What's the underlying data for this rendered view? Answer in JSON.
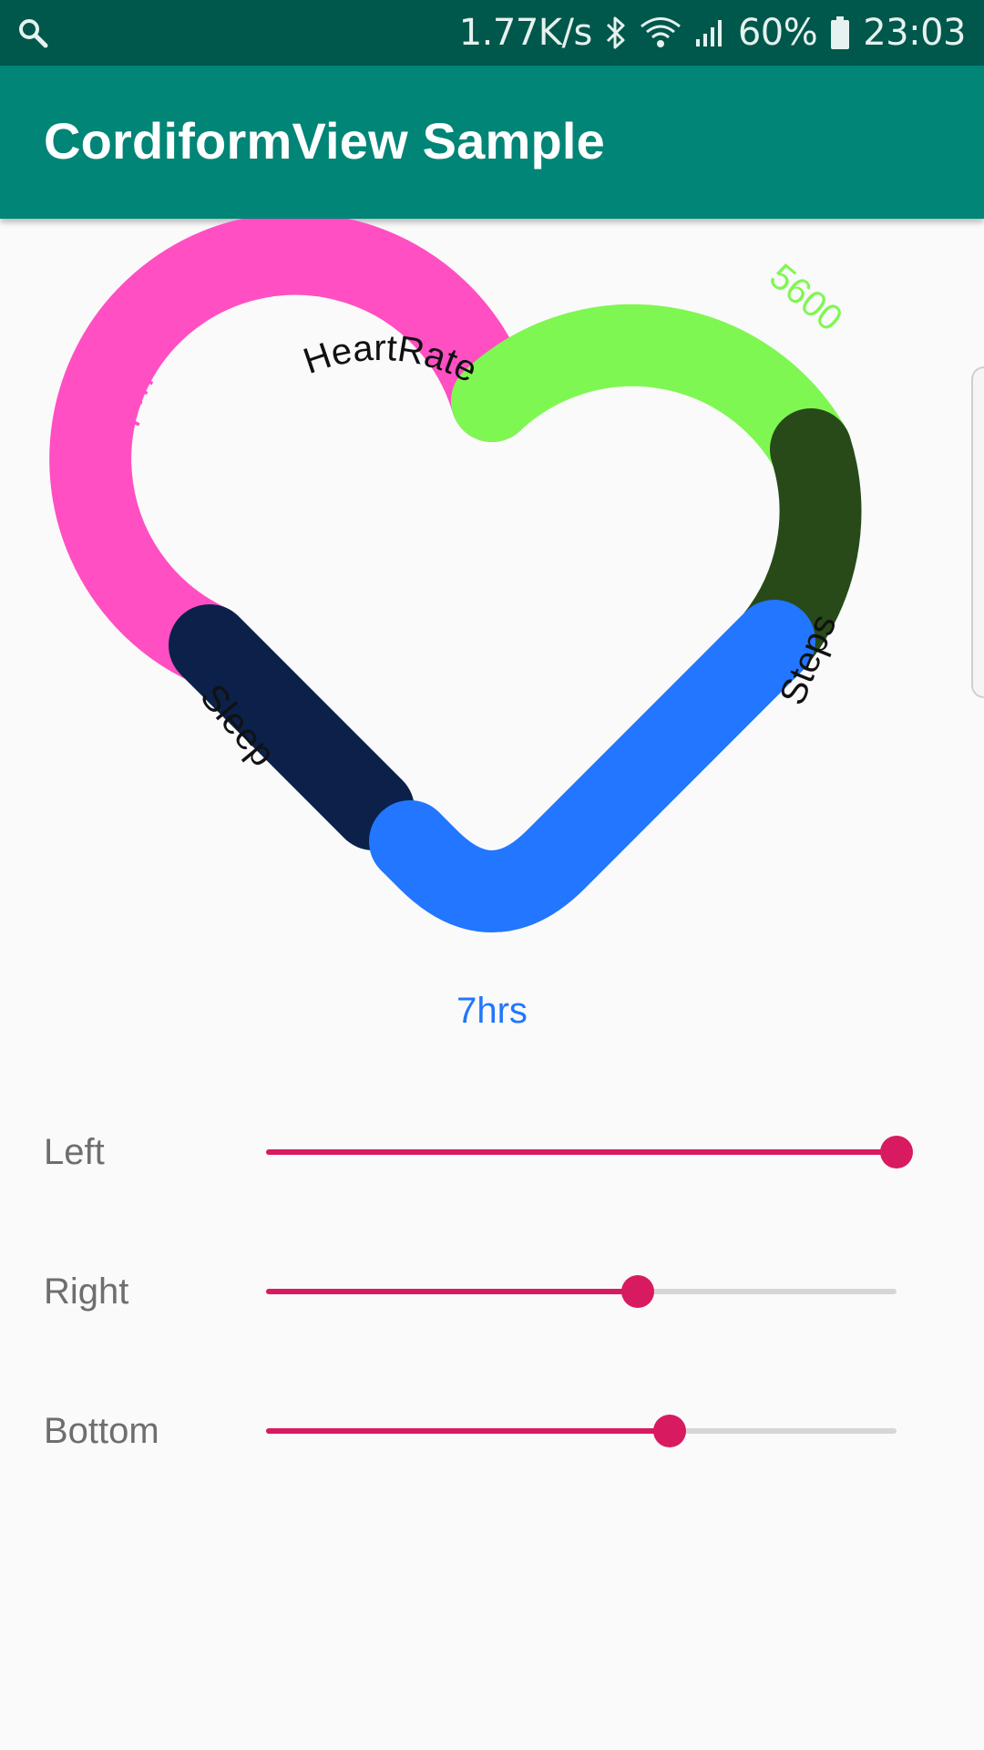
{
  "status_bar": {
    "net_speed": "1.77K/s",
    "battery": "60%",
    "time": "23:03",
    "icons": [
      "search-icon",
      "bluetooth-icon",
      "wifi-icon",
      "signal-icon",
      "battery-icon"
    ]
  },
  "app_bar": {
    "title": "CordiformView Sample",
    "color": "#008577"
  },
  "heart": {
    "segments": [
      {
        "label": "HeartRate",
        "value_text": "68bpm",
        "color": "#ff4fc3"
      },
      {
        "label": "Steps",
        "value_text": "5600",
        "color": "#7ff752"
      },
      {
        "label": "Sleep",
        "value_text": "7hrs",
        "color": "#2276ff"
      }
    ],
    "overlay_colors": {
      "steps": "#284a18",
      "sleep": "#0b214a"
    }
  },
  "sliders": [
    {
      "label": "Left",
      "value": 1.0
    },
    {
      "label": "Right",
      "value": 0.59
    },
    {
      "label": "Bottom",
      "value": 0.64
    }
  ],
  "accent_color": "#d81b60"
}
